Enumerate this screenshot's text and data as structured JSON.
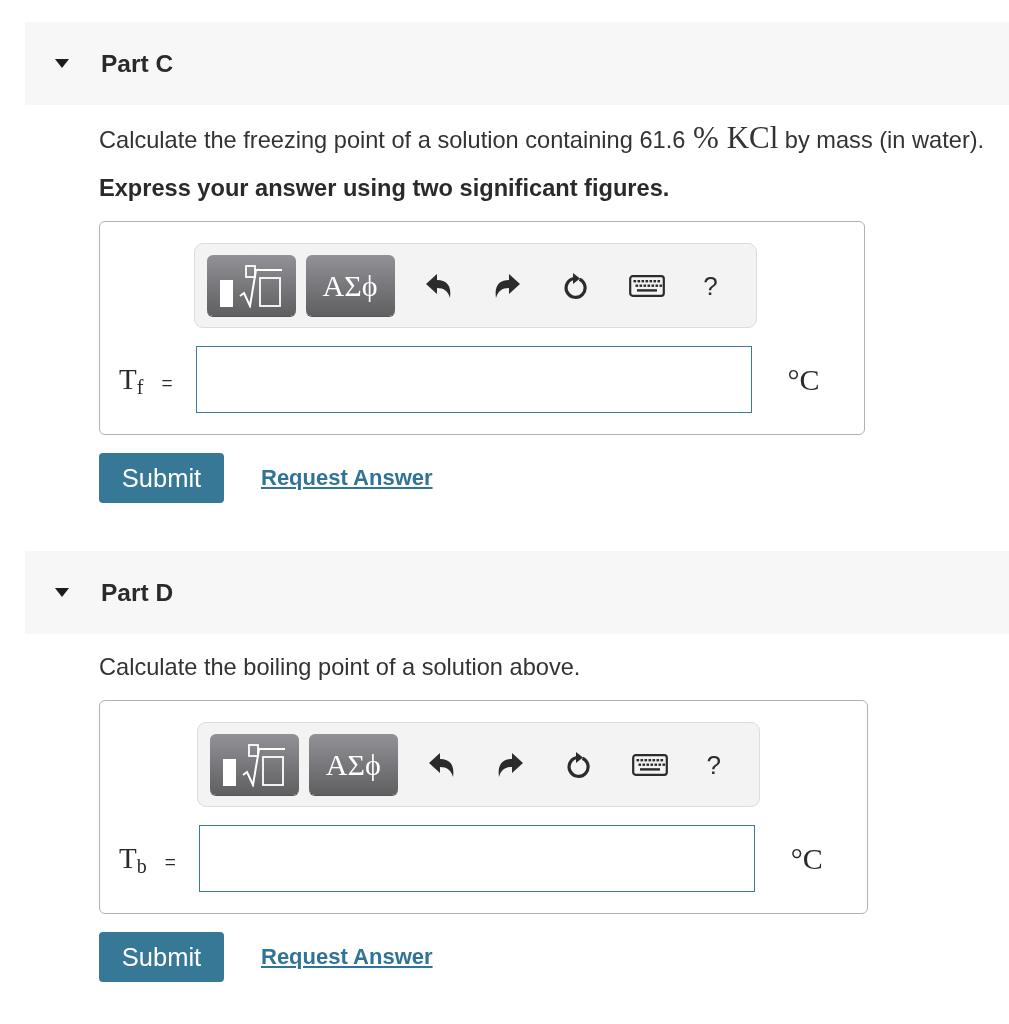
{
  "parts": [
    {
      "title": "Part C",
      "expanded": true,
      "question": [
        {
          "kind": "text",
          "text": "Calculate the freezing point of a solution containing 61.6"
        },
        {
          "kind": "math",
          "text": "% KCl"
        },
        {
          "kind": "text",
          "text": "by mass (in water)."
        }
      ],
      "instruction": "Express your answer using two significant figures.",
      "answer": {
        "toolbar": [
          {
            "kind": "templates"
          },
          {
            "kind": "symbols",
            "label": "ΑΣϕ"
          },
          {
            "kind": "undo"
          },
          {
            "kind": "redo"
          },
          {
            "kind": "reset"
          },
          {
            "kind": "keyboard"
          },
          {
            "kind": "help",
            "label": "?"
          }
        ],
        "variable": "T$_{f}$",
        "relation": "=",
        "unit": "°C"
      },
      "actions": {
        "submit": "Submit",
        "request_answer": "Request Answer"
      }
    },
    {
      "title": "Part D",
      "expanded": true,
      "question": [
        {
          "kind": "text",
          "text": "Calculate the boiling point of a solution above."
        }
      ],
      "answer": {
        "toolbar": [
          {
            "kind": "templates"
          },
          {
            "kind": "symbols",
            "label": "ΑΣϕ"
          },
          {
            "kind": "undo"
          },
          {
            "kind": "redo"
          },
          {
            "kind": "reset"
          },
          {
            "kind": "keyboard"
          },
          {
            "kind": "help",
            "label": "?"
          }
        ],
        "variable": "T$_{b}$",
        "relation": "=",
        "unit": "°C"
      },
      "actions": {
        "submit": "Submit",
        "request_answer": "Request Answer"
      }
    }
  ]
}
